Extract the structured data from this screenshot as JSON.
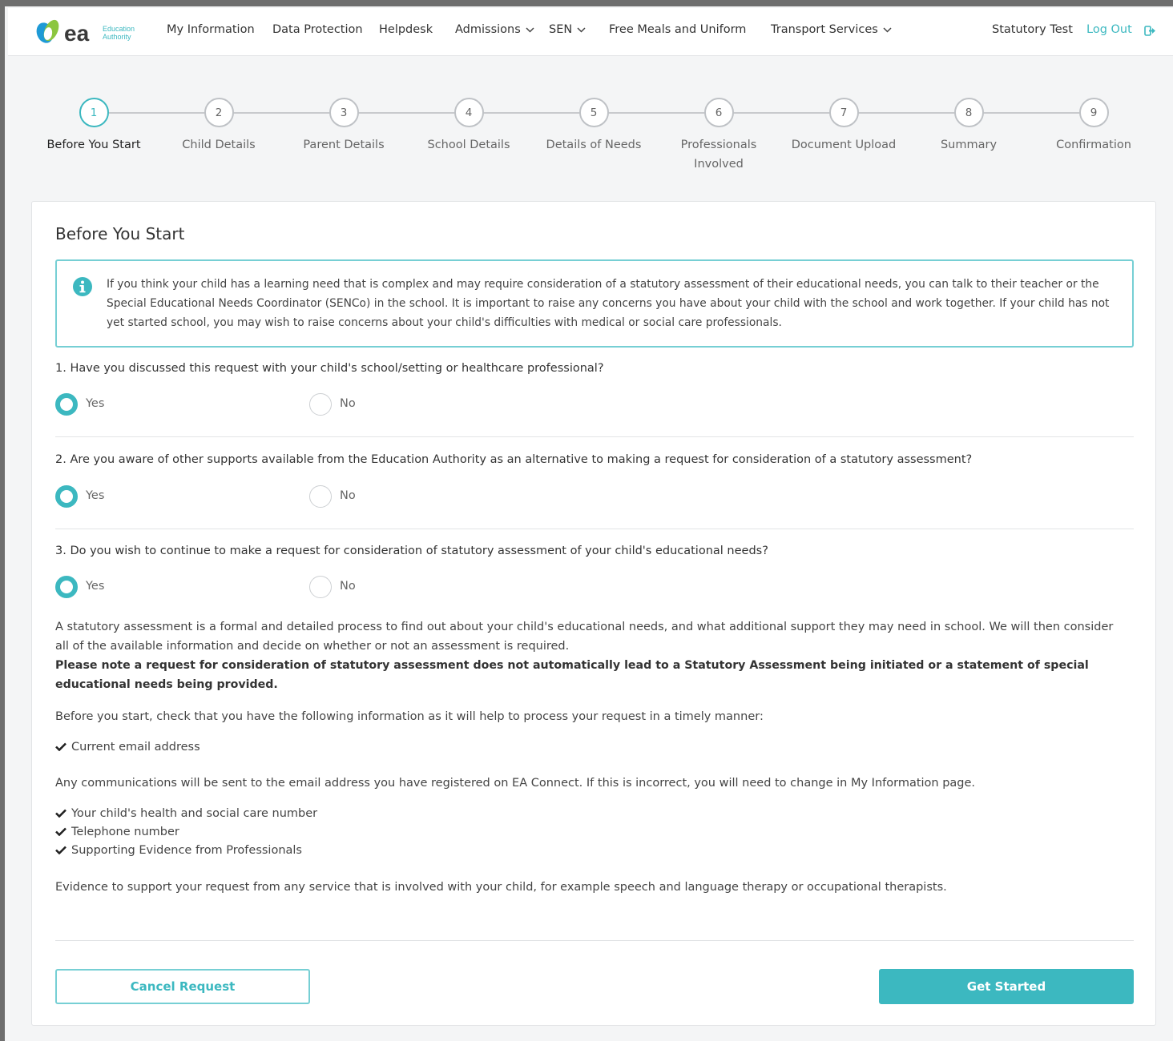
{
  "header": {
    "logo": {
      "brand": "ea",
      "tagline_line1": "Education",
      "tagline_line2": "Authority"
    },
    "nav": [
      {
        "label": "My Information"
      },
      {
        "label": "Data Protection"
      },
      {
        "label": "Helpdesk"
      },
      {
        "label": "Admissions"
      },
      {
        "label": "SEN"
      },
      {
        "label": "Free Meals and Uniform"
      },
      {
        "label": "Transport Services"
      }
    ],
    "user_name": "Statutory Test",
    "logout_label": "Log Out"
  },
  "stepper": {
    "steps": [
      {
        "number": "1",
        "label": "Before You Start"
      },
      {
        "number": "2",
        "label": "Child Details"
      },
      {
        "number": "3",
        "label": "Parent Details"
      },
      {
        "number": "4",
        "label": "School Details"
      },
      {
        "number": "5",
        "label": "Details of Needs"
      },
      {
        "number": "6",
        "label": "Professionals Involved"
      },
      {
        "number": "7",
        "label": "Document Upload"
      },
      {
        "number": "8",
        "label": "Summary"
      },
      {
        "number": "9",
        "label": "Confirmation"
      }
    ]
  },
  "card": {
    "title": "Before You Start",
    "info_text": "If you think your child has a learning need that is complex and may require consideration of a statutory assessment of their educational needs, you can talk to their teacher or the Special Educational Needs Coordinator (SENCo) in the school. It is important to raise any concerns you have about your child with the school and work together. If your child has not yet started school, you may wish to raise concerns about your child's difficulties with medical or social care professionals.",
    "questions": [
      {
        "text": "1. Have you discussed this request with your child's school/setting or healthcare professional?",
        "yes_label": "Yes",
        "no_label": "No",
        "selected": "Yes"
      },
      {
        "text": "2. Are you aware of other supports available from the Education Authority as an alternative to making a request for consideration of a statutory assessment?",
        "yes_label": "Yes",
        "no_label": "No",
        "selected": "Yes"
      },
      {
        "text": "3. Do you wish to continue to make a request for consideration of statutory assessment of your child's educational needs?",
        "yes_label": "Yes",
        "no_label": "No",
        "selected": "Yes"
      }
    ],
    "para_assessment": "A statutory assessment is a formal and detailed process to find out about your child's educational needs, and what additional support they may need in school. We will then consider all of the available information and decide on whether or not an assessment is required.",
    "para_note": "Please note a request for consideration of statutory assessment does not automatically lead to a Statutory Assessment being initiated or a statement of special educational needs being provided.",
    "para_before": "Before you start, check that you have the following information as it will help to process your request in a timely manner:",
    "check_email": "Current email address",
    "para_comms": "Any communications will be sent to the email address you have registered on EA Connect. If this is incorrect, you will need to change in My Information page.",
    "checklist": [
      "Your child's health and social care number",
      "Telephone number",
      "Supporting Evidence from Professionals"
    ],
    "para_evidence": "Evidence to support your request from any service that is involved with your child, for example speech and language therapy or occupational therapists.",
    "cancel_label": "Cancel Request",
    "start_label": "Get Started"
  },
  "colors": {
    "accent": "#3cb8c0",
    "accent_light": "#76cfd4",
    "logo_green": "#8cc63f",
    "logo_blue": "#1e9ad6"
  }
}
